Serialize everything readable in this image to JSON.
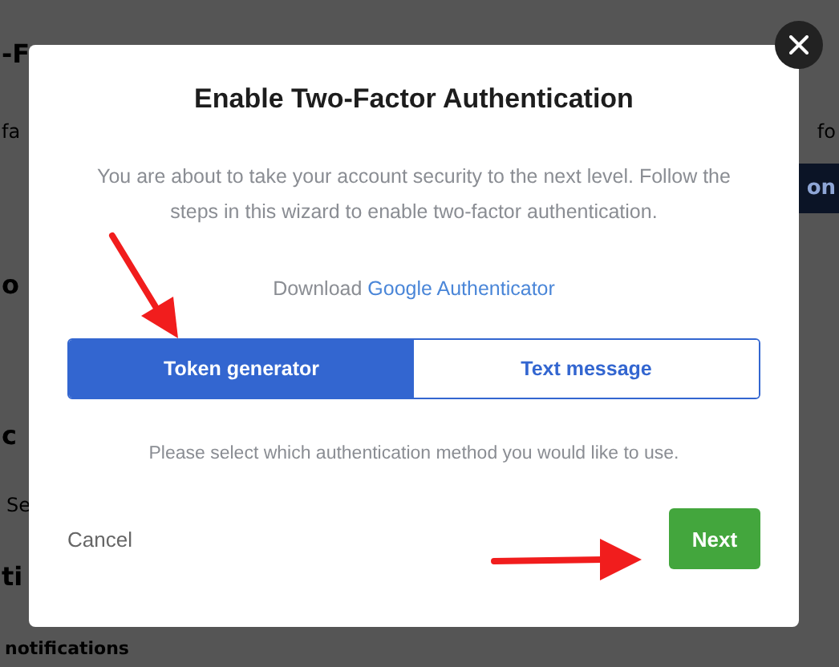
{
  "background": {
    "heading": "-F",
    "intro_left": "fa",
    "intro_right": "fo",
    "action_button": "on",
    "section_1": "o",
    "section_2": "c",
    "section_2_text": "Se",
    "section_3": "ti",
    "section_3_label": "notifications"
  },
  "dialog": {
    "title": "Enable Two-Factor Authentication",
    "intro": "You are about to take your account security to the next level. Follow the steps in this wizard to enable two-factor authentication.",
    "download_label": "Download",
    "download_link": "Google Authenticator",
    "methods": [
      {
        "label": "Token generator",
        "selected": true
      },
      {
        "label": "Text message",
        "selected": false
      }
    ],
    "hint": "Please select which authentication method you would like to use.",
    "cancel": "Cancel",
    "next": "Next"
  }
}
